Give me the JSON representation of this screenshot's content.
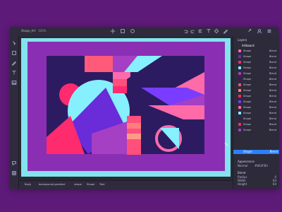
{
  "window": {
    "title": "Shape_Art",
    "zoom": "100%",
    "tool_icons": [
      "move-icon",
      "select-icon",
      "pen-icon",
      "shape-icon",
      "text-icon",
      "gear-icon"
    ]
  },
  "left_toolbar": {
    "icons": [
      "pointer-icon",
      "frame-icon",
      "pen-icon",
      "text-icon",
      "image-icon",
      "comment-icon",
      "grid-icon"
    ]
  },
  "right_panel": {
    "header": "Layers",
    "section_title": "Artboard",
    "layers": [
      {
        "name": "Shape",
        "value": "Blend",
        "color": "#ff6aa9"
      },
      {
        "name": "Shape",
        "value": "Blend",
        "color": "#6a2bd9"
      },
      {
        "name": "Shape",
        "value": "Blend",
        "color": "#ff2b6f"
      },
      {
        "name": "Shape",
        "value": "Blend",
        "color": "#86f0ff"
      },
      {
        "name": "Shape",
        "value": "Blend",
        "color": "#a53fc4"
      },
      {
        "name": "Shape",
        "value": "Blend",
        "color": "#3a1a5a"
      },
      {
        "name": "Shape",
        "value": "Blend",
        "color": "#ff4f7c"
      },
      {
        "name": "Shape",
        "value": "Blend",
        "color": "#ff8a6a"
      },
      {
        "name": "Shape",
        "value": "Blend",
        "color": "#ff2b6f"
      },
      {
        "name": "Shape",
        "value": "Blend",
        "color": "#7a3cff"
      },
      {
        "name": "Shape",
        "value": "Blend",
        "color": "#ff6aa9"
      },
      {
        "name": "Shape",
        "value": "Blend",
        "color": "#86f0ff"
      },
      {
        "name": "Shape",
        "value": "Blend",
        "color": "#3a1a5a"
      },
      {
        "name": "Shape",
        "value": "Blend",
        "color": "#ff2b6f"
      },
      {
        "name": "Shape",
        "value": "Blend",
        "color": "#a53fc4"
      }
    ],
    "selected_layer": "Shape",
    "selected_value": "Blend",
    "appearance": {
      "label": "Appearance",
      "mode": "Normal",
      "opacity_label": "Opacity",
      "opacity": "100%",
      "fill_label": "Fill",
      "fill": "#8A2FB3"
    },
    "blend": {
      "label": "Blend",
      "rows": [
        "Radius",
        "Width",
        "Height",
        "Angle"
      ],
      "values": [
        "0",
        "64",
        "64",
        "0°"
      ]
    }
  },
  "bottom_bar": {
    "items": [
      "Body",
      "background-gradient",
      "shape",
      "Shape",
      "Text"
    ]
  },
  "colors": {
    "desktop": "#5e1a79",
    "artboard_bg": "#83e3ee",
    "accent": "#2a80ff"
  }
}
